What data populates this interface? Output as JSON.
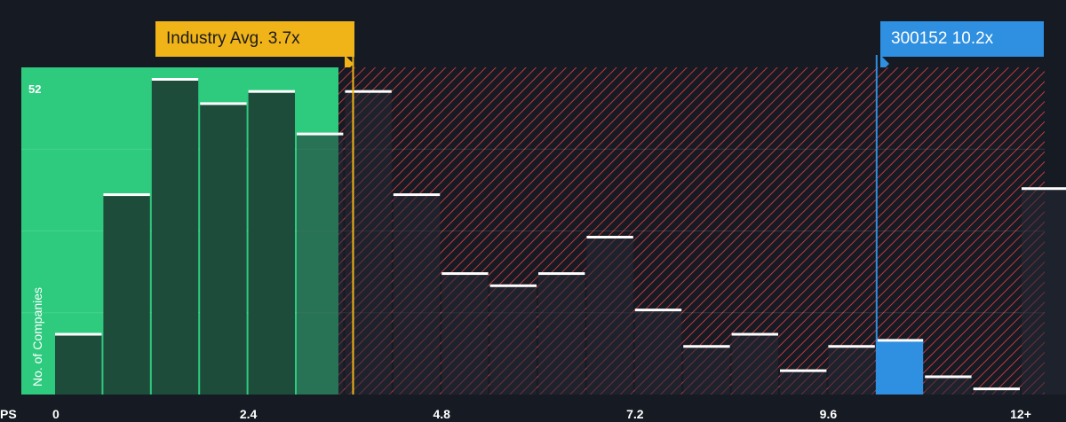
{
  "chart_data": {
    "type": "bar",
    "x_axis_label": "PS",
    "y_axis_label": "No. of Companies",
    "y_max_label": "52",
    "x_ticks": [
      "0",
      "2.4",
      "4.8",
      "7.2",
      "9.6",
      "12+"
    ],
    "bin_width": 0.6,
    "values": [
      10,
      33,
      52,
      48,
      50,
      43,
      50,
      33,
      20,
      18,
      20,
      26,
      14,
      8,
      10,
      4,
      8,
      9,
      3,
      1,
      34
    ],
    "ylim": [
      0,
      52
    ],
    "industry_avg": {
      "label": "Industry Avg. 3.7x",
      "value": 3.7
    },
    "company": {
      "label": "300152 10.2x",
      "value": 10.2,
      "bin_index": 17
    },
    "grid": true
  },
  "colors": {
    "background": "#151a23",
    "fair_zone": "#2ecb7f",
    "fair_bar": "#1e4c3a",
    "over_zone_stripe": "#c0393f",
    "over_bar": "#242a35",
    "industry_line": "#f1b418",
    "company_bar": "#2f8fe0",
    "bar_top": "#ffffff",
    "text": "#ffffff"
  }
}
